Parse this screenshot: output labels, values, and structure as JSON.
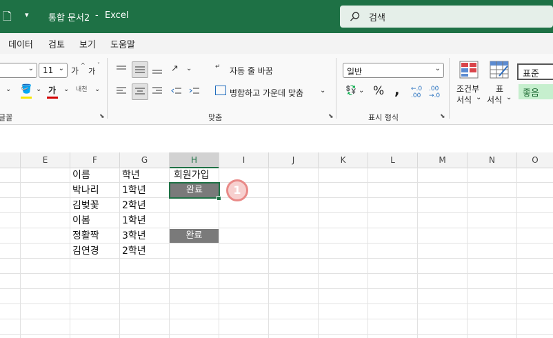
{
  "titlebar": {
    "doc_title": "통합 문서2",
    "separator": "-",
    "app_name": "Excel",
    "search_label": "검색",
    "bg_color": "#1e7145"
  },
  "tabs": [
    "데이터",
    "검토",
    "보기",
    "도움말"
  ],
  "ribbon": {
    "font_size": "11",
    "grow_font": "가",
    "shrink_font": "가",
    "font_color_letter": "가",
    "phonetic": "내천",
    "wrap_text": "자동 줄 바꿈",
    "merge_center": "병합하고 가운데 맞춤",
    "number_format": "일반",
    "percent": "%",
    "comma": ",",
    "conditional_format_l1": "조건부",
    "conditional_format_l2": "서식",
    "format_table_l1": "표",
    "format_table_l2": "서식",
    "style_normal": "표준",
    "style_good": "좋음",
    "group_font": "글꼴",
    "group_alignment": "맞춤",
    "group_number": "표시 형식"
  },
  "columns": [
    "E",
    "F",
    "G",
    "H",
    "I",
    "J",
    "K",
    "L",
    "M",
    "N",
    "O"
  ],
  "selected_column": "H",
  "cells": {
    "header": {
      "name": "이름",
      "grade": "학년",
      "member": "회원가입"
    },
    "rows": [
      {
        "name": "박나리",
        "grade": "1학년",
        "member": "완료"
      },
      {
        "name": "김벚꽃",
        "grade": "2학년",
        "member": ""
      },
      {
        "name": "이봄",
        "grade": "1학년",
        "member": ""
      },
      {
        "name": "정활짝",
        "grade": "3학년",
        "member": "완료"
      },
      {
        "name": "김연경",
        "grade": "2학년",
        "member": ""
      }
    ]
  },
  "marker": "1"
}
